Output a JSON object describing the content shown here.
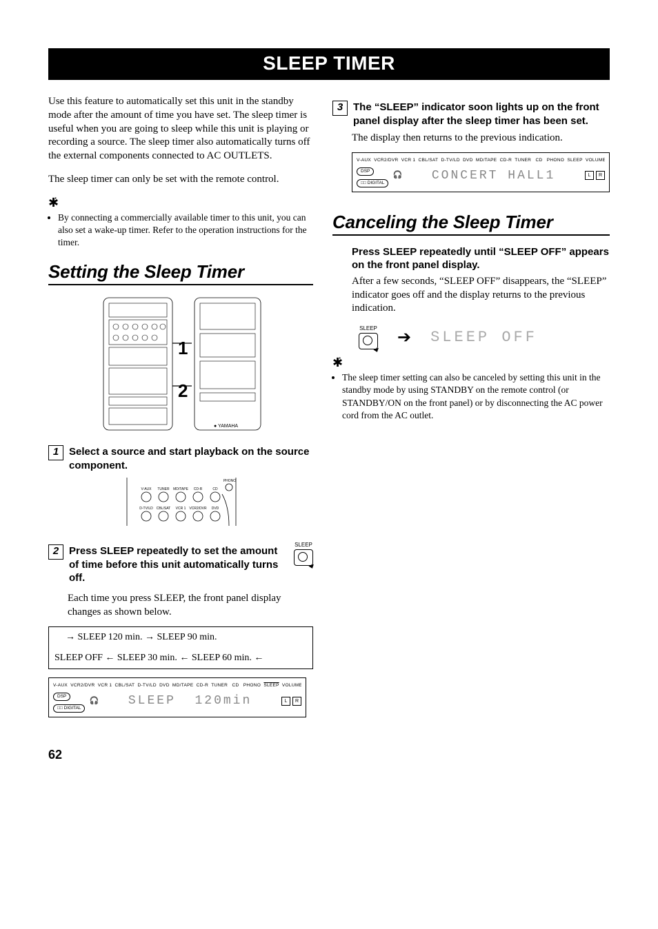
{
  "title": "SLEEP TIMER",
  "page_number": "62",
  "left": {
    "intro": "Use this feature to automatically set this unit in the standby mode after the amount of time you have set. The sleep timer is useful when you are going to sleep while this unit is playing or recording a source. The sleep timer also automatically turns off the external components connected to AC OUTLETS.",
    "note": "The sleep timer can only be set with the remote control.",
    "tip1": "By connecting a commercially available timer to this unit, you can also set a wake-up timer. Refer to the operation instructions for the timer.",
    "heading": "Setting the Sleep Timer",
    "callout1": "1",
    "callout2": "2",
    "step1_title": "Select a source and start playback on the source component.",
    "src_labels_top": [
      "V-AUX",
      "TUNER",
      "MD/TAPE",
      "CD-R",
      "CD",
      "PHONO"
    ],
    "src_labels_bottom": [
      "D-TV/LD",
      "CBL/SAT",
      "VCR 1",
      "VCR2/DVR",
      "DVD"
    ],
    "step2_title": "Press SLEEP repeatedly to set the amount of time before this unit automatically turns off.",
    "step2_body": "Each time you press SLEEP, the front panel display changes as shown below.",
    "sleep_label": "SLEEP",
    "seq_row1": "→ SLEEP 120 min. → SLEEP 90 min.",
    "seq_row2": "SLEEP OFF ← SLEEP 30 min. ← SLEEP 60 min. ←",
    "lcd1_sources": "V-AUX  VCR2/DVR  VCR 1  CBL/SAT  D-TV/LD  DVD  MD/TAPE  CD-R  TUNER   CD   PHONO",
    "lcd1_sleep": "SLEEP",
    "lcd1_volume": "VOLUME",
    "lcd_dsp": "DSP",
    "lcd_digital": "□□ DIGITAL",
    "lcd1_text": "SLEEP  120min",
    "lcd_L": "L",
    "lcd_R": "R"
  },
  "right": {
    "step3_title": "The “SLEEP” indicator soon lights up on the front panel display after the sleep timer has been set.",
    "step3_body": "The display then returns to the previous indication.",
    "lcd2_sources": "V-AUX  VCR2/DVR  VCR 1  CBL/SAT  D-TV/LD  DVD  MD/TAPE  CD-R  TUNER   CD   PHONO",
    "lcd2_text": "CONCERT HALL1",
    "heading2": "Canceling the Sleep Timer",
    "cancel_title": "Press SLEEP repeatedly until “SLEEP OFF” appears on the front panel display.",
    "cancel_body": "After a few seconds, “SLEEP OFF” disappears, the “SLEEP” indicator goes off and the display returns to the previous indication.",
    "sleep_off": "SLEEP OFF",
    "tip2": "The sleep timer setting can also be canceled by setting this unit in the standby mode by using STANDBY on the remote control (or STANDBY/ON on the front panel) or by disconnecting the AC power cord from the AC outlet."
  }
}
